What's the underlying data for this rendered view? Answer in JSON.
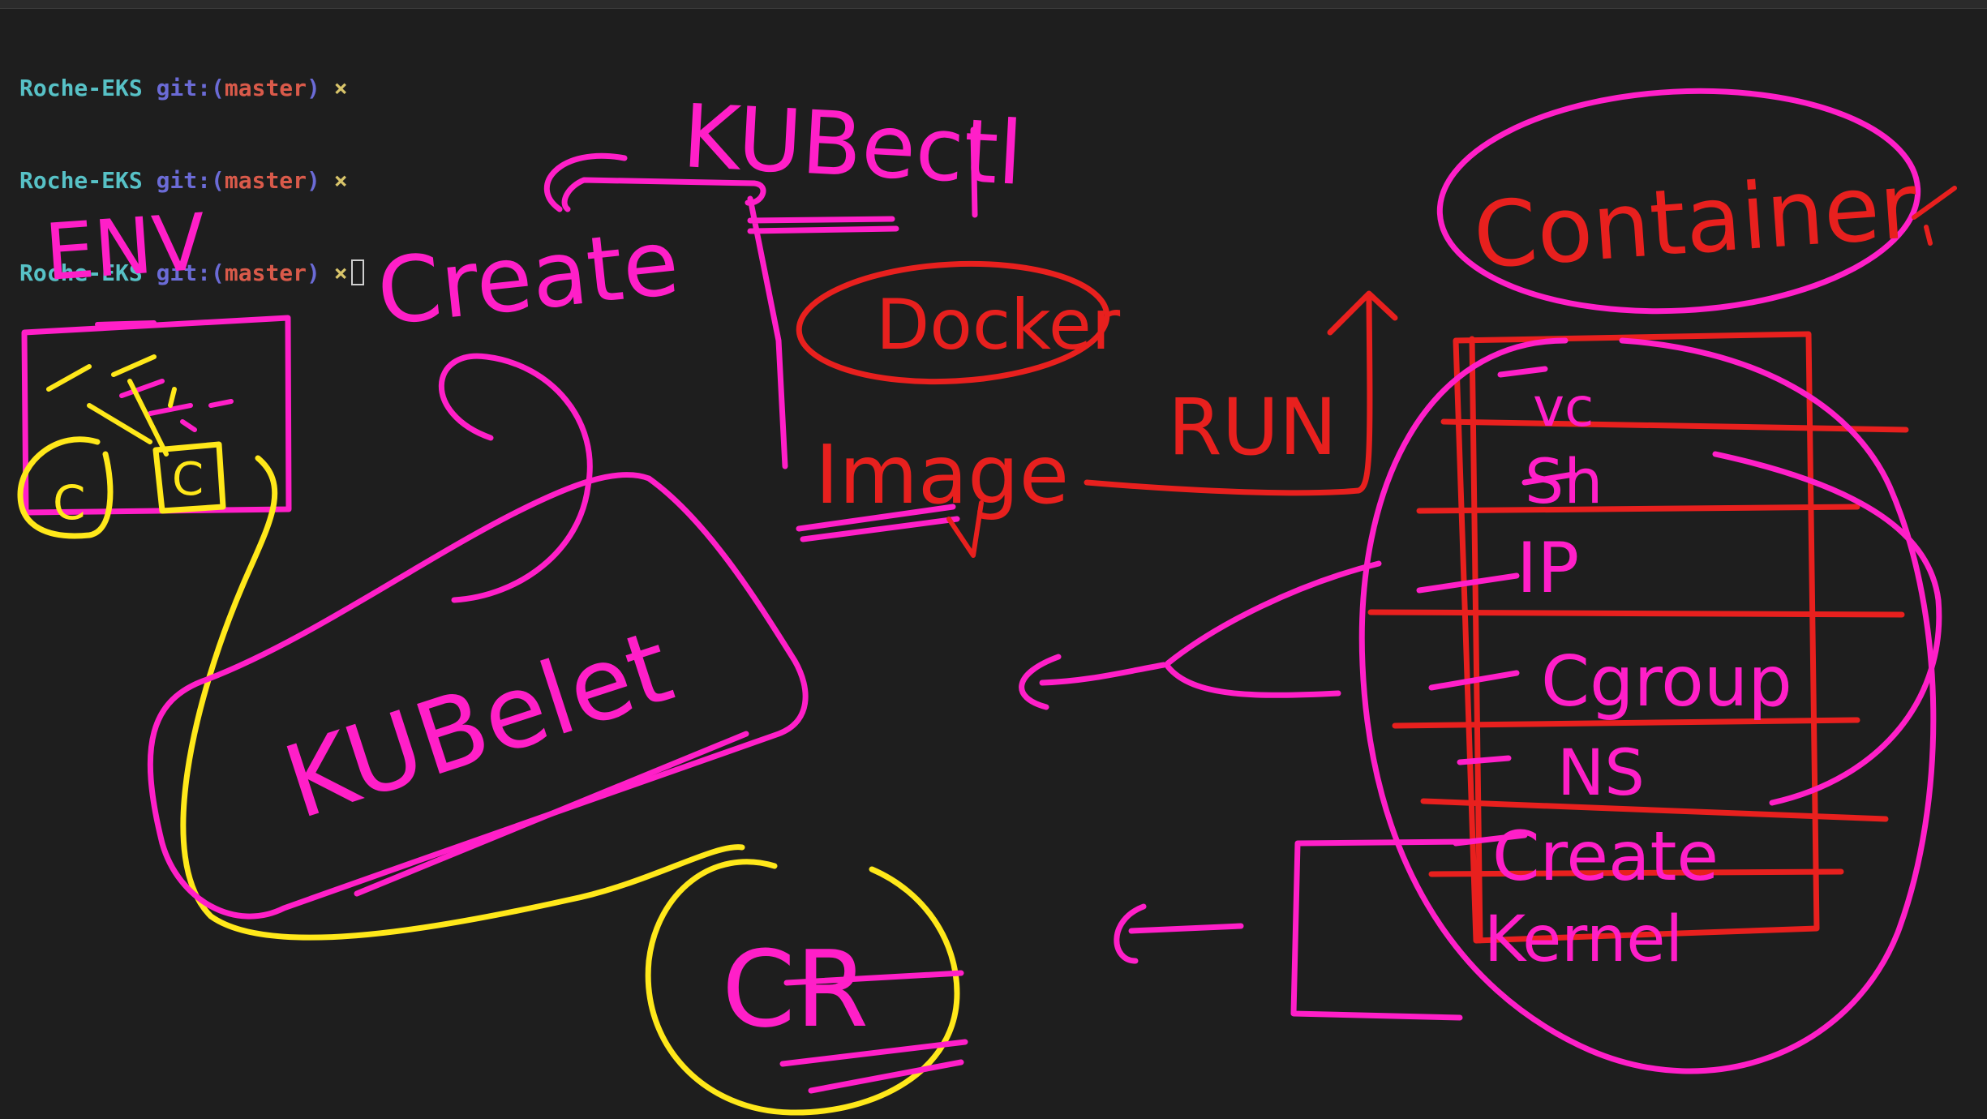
{
  "terminal": {
    "lines": [
      {
        "dir": "Roche-EKS",
        "git": "git:(",
        "branch": "master",
        "close": ")",
        "mark": "×"
      },
      {
        "dir": "Roche-EKS",
        "git": "git:(",
        "branch": "master",
        "close": ")",
        "mark": "×"
      },
      {
        "dir": "Roche-EKS",
        "git": "git:(",
        "branch": "master",
        "close": ")",
        "mark": "×"
      }
    ]
  },
  "drawing": {
    "colors": {
      "magenta": "#ff1fc8",
      "red": "#e8201e",
      "yellow": "#ffe81a"
    },
    "labels": {
      "env": "ENV",
      "kubectl": "KUBectl",
      "create_top": "Create",
      "docker": "Docker",
      "image": "Image",
      "run": "RUN",
      "container": "Container",
      "kubelet": "KUBelet",
      "cr": "CR",
      "vc": "vc",
      "sh": "Sh",
      "ip": "IP",
      "cgroup": "Cgroup",
      "ns": "NS",
      "create_stack": "Create",
      "kernel": "Kernel",
      "env_c1": "C",
      "env_c2": "C"
    }
  }
}
